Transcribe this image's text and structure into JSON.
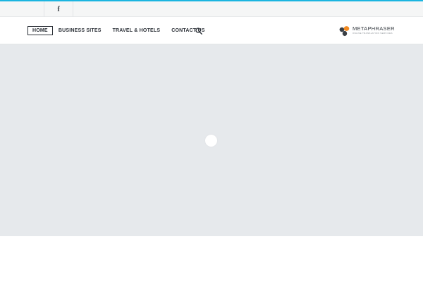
{
  "colors": {
    "accent": "#1cb5e0",
    "topbar_bg": "#f5f6f6",
    "hero_bg": "#e6e9ec",
    "nav_text": "#2a2f36",
    "logo_orange": "#f28a21",
    "logo_dark": "#3a3f45"
  },
  "topbar": {
    "social": {
      "facebook_glyph": "f",
      "icon": "facebook-icon"
    }
  },
  "nav": {
    "items": [
      {
        "label": "HOME",
        "active": true
      },
      {
        "label": "BUSINESS SITES",
        "active": false
      },
      {
        "label": "TRAVEL & HOTELS",
        "active": false
      },
      {
        "label": "CONTACT US",
        "active": false
      }
    ],
    "search_icon": "search-icon"
  },
  "logo": {
    "title": "METAPHRASER",
    "subtitle": "ONLINE TRANSLATION SERVICES"
  }
}
